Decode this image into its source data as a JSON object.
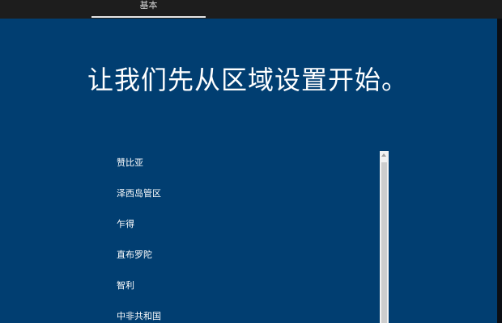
{
  "topbar": {
    "active_tab_label": "基本"
  },
  "main": {
    "title": "让我们先从区域设置开始。"
  },
  "region_list": {
    "items": [
      {
        "label": "赞比亚"
      },
      {
        "label": "泽西岛管区"
      },
      {
        "label": "乍得"
      },
      {
        "label": "直布罗陀"
      },
      {
        "label": "智利"
      },
      {
        "label": "中非共和国"
      }
    ]
  },
  "colors": {
    "background": "#003d70",
    "topbar": "#1d1d1d",
    "text": "#ffffff"
  }
}
